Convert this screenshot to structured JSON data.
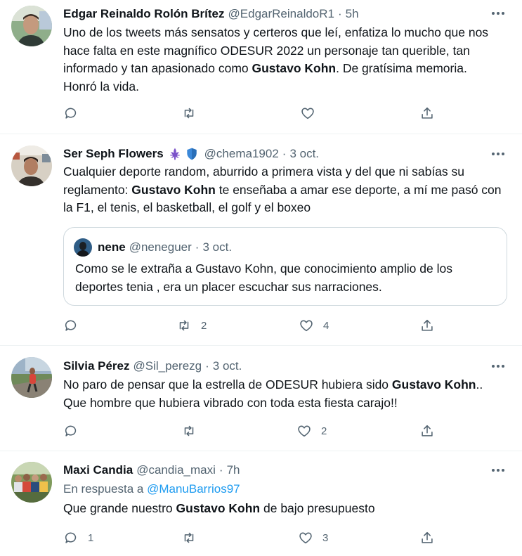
{
  "tweets": [
    {
      "name": "Edgar Reinaldo Rolón Brítez",
      "handle": "@EdgarReinaldoR1",
      "sep": "·",
      "time": "5h",
      "text": [
        {
          "t": "Uno de los tweets más sensatos y certeros que leí, enfatiza lo mucho que nos hace falta en este magnífico ODESUR 2022 un personaje tan querible, tan informado y tan apasionado como "
        },
        {
          "b": "Gustavo Kohn"
        },
        {
          "t": ". De gratísima memoria. Honró la vida."
        }
      ],
      "actions": {
        "reply": "",
        "retweet": "",
        "like": ""
      }
    },
    {
      "name": "Ser Seph Flowers",
      "handle": "@chema1902",
      "sep": "·",
      "time": "3 oct.",
      "text": [
        {
          "t": "Cualquier deporte random, aburrido a primera vista y del que ni sabías su reglamento: "
        },
        {
          "b": "Gustavo Kohn"
        },
        {
          "t": " te enseñaba a amar ese deporte, a mí me pasó con la F1, el tenis, el basketball, el golf y el boxeo"
        }
      ],
      "quote": {
        "name": "nene",
        "handle": "@neneguer",
        "sep": "·",
        "time": "3 oct.",
        "text": "Como se le extraña a Gustavo Kohn, que conocimiento amplio de los deportes tenia , era un placer escuchar sus narraciones."
      },
      "actions": {
        "reply": "",
        "retweet": "2",
        "like": "4"
      }
    },
    {
      "name": "Silvia Pérez",
      "handle": "@Sil_perezg",
      "sep": "·",
      "time": "3 oct.",
      "text": [
        {
          "t": "No paro de pensar que la estrella de ODESUR hubiera sido "
        },
        {
          "b": "Gustavo Kohn"
        },
        {
          "t": ".. Que hombre que hubiera vibrado con toda esta fiesta carajo!!"
        }
      ],
      "actions": {
        "reply": "",
        "retweet": "",
        "like": "2"
      }
    },
    {
      "name": "Maxi Candia",
      "handle": "@candia_maxi",
      "sep": "·",
      "time": "7h",
      "reply_prefix": "En respuesta a ",
      "reply_to": "@ManuBarrios97",
      "text": [
        {
          "t": "Que grande nuestro "
        },
        {
          "b": "Gustavo Kohn"
        },
        {
          "t": " de bajo presupuesto"
        }
      ],
      "actions": {
        "reply": "1",
        "retweet": "",
        "like": "3"
      }
    }
  ],
  "icons": {
    "reply": "reply-icon",
    "retweet": "retweet-icon",
    "like": "like-icon",
    "share": "share-icon",
    "more": "more-icon",
    "badge1": "fleur-de-lis-icon",
    "badge2": "shield-icon"
  },
  "colors": {
    "text": "#0f1419",
    "secondary": "#536471",
    "link": "#1d9bf0",
    "divider": "#eff3f4",
    "border": "#cfd9de",
    "fleur": "#7b52c9",
    "shield": "#3b88d8"
  }
}
